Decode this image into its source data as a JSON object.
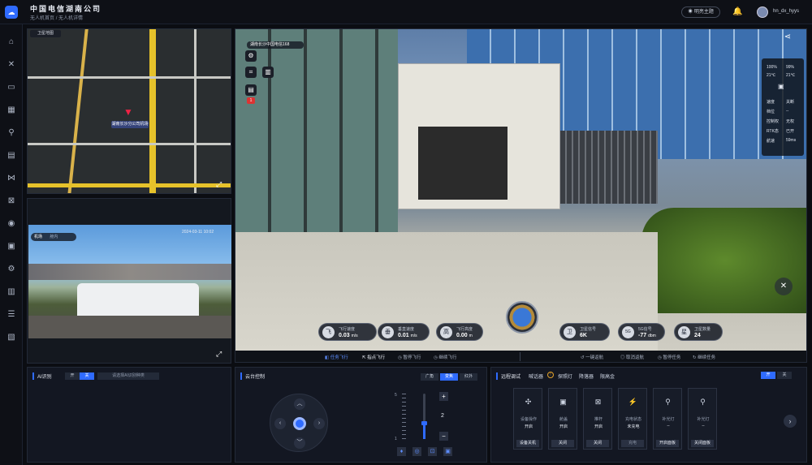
{
  "header": {
    "company": "中国电信湖南公司",
    "breadcrumb": [
      "无人机首页",
      "无人机详情"
    ],
    "theme_button": "明亮主题",
    "username": "hn_dx_hyys"
  },
  "sidebar": {
    "icons": [
      "home-icon",
      "drone-icon",
      "folder-icon",
      "grid-icon",
      "route-icon",
      "dashboard-icon",
      "waypoint-icon",
      "frame-icon",
      "camera-icon",
      "file-icon",
      "settings-icon",
      "chart-icon",
      "server-icon",
      "layout-icon"
    ]
  },
  "map": {
    "mode_label": "卫星地图",
    "station_label": "湖南长沙分公司机场"
  },
  "camera": {
    "tag_label": "机场",
    "tag_sub": "舱内",
    "timestamp": "2024-03-11 10:02"
  },
  "main_video": {
    "station_title": "湖南长沙中国电信168",
    "badge": "1",
    "right_values": {
      "top": [
        "100%",
        "99%",
        "21℃",
        "21℃"
      ],
      "rows": [
        {
          "label": "速度",
          "value": "关断"
        },
        {
          "label": "档位",
          "value": "--"
        },
        {
          "label": "控制权",
          "value": "无权"
        },
        {
          "label": "RTK态",
          "value": "已开"
        },
        {
          "label": "航速",
          "value": "59ms"
        }
      ]
    },
    "stats": [
      {
        "icon": "飞",
        "label": "飞行速度",
        "value": "0.03",
        "unit": "m/s"
      },
      {
        "icon": "垂",
        "label": "垂直速度",
        "value": "0.01",
        "unit": "m/s"
      },
      {
        "icon": "高",
        "label": "飞行高度",
        "value": "0.00",
        "unit": "m"
      },
      {
        "icon": "卫",
        "label": "卫星信号",
        "value": "6K",
        "unit": ""
      },
      {
        "icon": "5G",
        "label": "5G信号",
        "value": "-77",
        "unit": "dbm"
      },
      {
        "icon": "星",
        "label": "卫星数量",
        "value": "24",
        "unit": ""
      }
    ],
    "controls_left": [
      "任务飞行",
      "指点飞行",
      "暂停飞行",
      "继续飞行"
    ],
    "controls_right": [
      "一键返航",
      "取消返航",
      "暂停任务",
      "继续任务"
    ]
  },
  "ai": {
    "title": "AI识别",
    "on": "开",
    "off": "关",
    "select_placeholder": "请选择AI识别种类"
  },
  "gimbal": {
    "title": "云台控制",
    "modes": [
      "广角",
      "变焦",
      "红外"
    ],
    "active_mode": "变焦",
    "zoom_max": "5",
    "zoom_min": "1",
    "zoom_value": "2"
  },
  "remote": {
    "tabs": [
      "远程调试",
      "喊话器",
      "探照灯",
      "降落器",
      "限高金"
    ],
    "on": "开",
    "off": "关",
    "cards": [
      {
        "icon": "控",
        "title": "设备操作",
        "state": "开启",
        "button": "设备关机"
      },
      {
        "icon": "舱",
        "title": "舱盖",
        "state": "开启",
        "button": "关闭"
      },
      {
        "icon": "杆",
        "title": "推杆",
        "state": "开启",
        "button": "关闭"
      },
      {
        "icon": "电",
        "title": "充电状态",
        "state": "未充电",
        "button": "充电"
      },
      {
        "icon": "灯",
        "title": "补光灯",
        "state": "--",
        "button": "开启面板"
      },
      {
        "icon": "灯",
        "title": "补光灯",
        "state": "--",
        "button": "关闭面板"
      }
    ]
  }
}
